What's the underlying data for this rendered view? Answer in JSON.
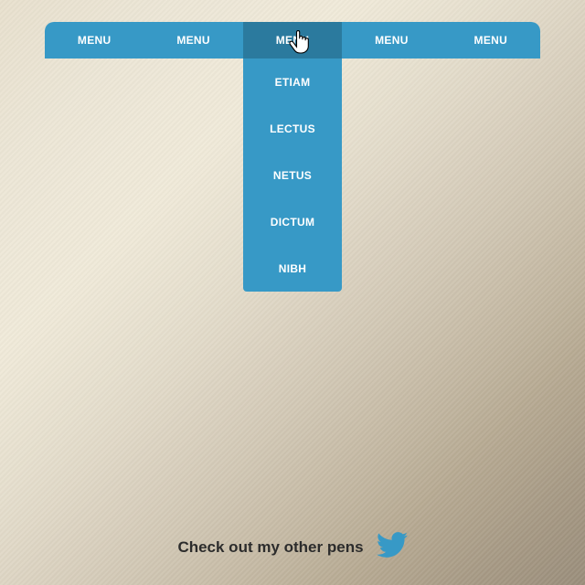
{
  "nav": {
    "items": [
      {
        "label": "MENU"
      },
      {
        "label": "MENU"
      },
      {
        "label": "MENU"
      },
      {
        "label": "MENU"
      },
      {
        "label": "MENU"
      }
    ],
    "active_index": 2,
    "dropdown": [
      {
        "label": "ETIAM"
      },
      {
        "label": "LECTUS"
      },
      {
        "label": "NETUS"
      },
      {
        "label": "DICTUM"
      },
      {
        "label": "NIBH"
      }
    ]
  },
  "footer": {
    "text": "Check out my other pens",
    "icon": "twitter-icon"
  },
  "colors": {
    "nav_bg": "#3799c6",
    "nav_active_bg": "#2b7a9e",
    "text_light": "#ffffff",
    "footer_text": "#2c2c2c"
  }
}
